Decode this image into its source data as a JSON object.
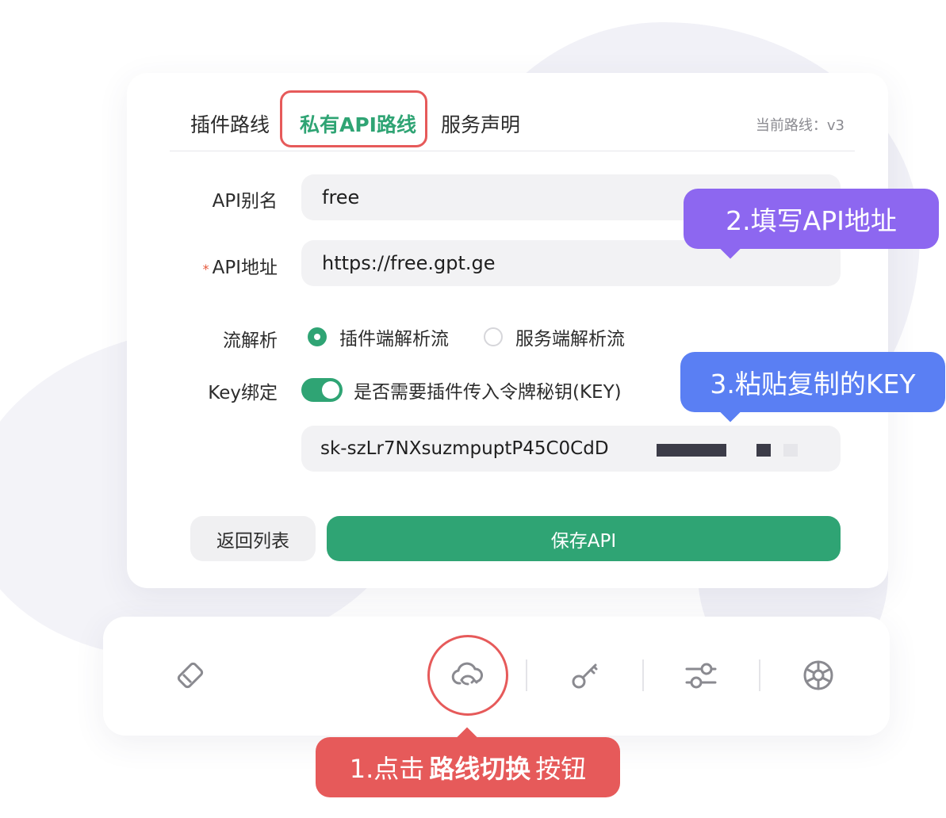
{
  "tabs": {
    "plugin_routes": "插件路线",
    "private_api_routes": "私有API路线",
    "service_statement": "服务声明"
  },
  "current_route": "当前路线：v3",
  "form": {
    "alias_label": "API别名",
    "alias_value": "free",
    "url_label": "API地址",
    "required_mark": "*",
    "url_value": "https://free.gpt.ge",
    "stream_label": "流解析",
    "stream_options": [
      "插件端解析流",
      "服务端解析流"
    ],
    "stream_selected": "插件端解析流",
    "key_label": "Key绑定",
    "key_toggle_text": "是否需要插件传入令牌秘钥(KEY)",
    "key_toggle_on": true,
    "key_value": "sk-szLr7NXsuzmpuptP45C0CdD"
  },
  "buttons": {
    "back": "返回列表",
    "save": "保存API"
  },
  "callouts": {
    "step1_prefix": "1.点击",
    "step1_bold": "路线切换",
    "step1_suffix": "按钮",
    "step2": "2.填写API地址",
    "step3": "3.粘贴复制的KEY"
  },
  "toolbar_icons": [
    "eraser-icon",
    "cloud-sync-icon",
    "key-icon",
    "sliders-icon",
    "aperture-icon"
  ],
  "colors": {
    "accent_green": "#2fa474",
    "highlight_red": "#e65a5a",
    "callout_purple": "#8d67f0",
    "callout_blue": "#5a7ff3"
  }
}
